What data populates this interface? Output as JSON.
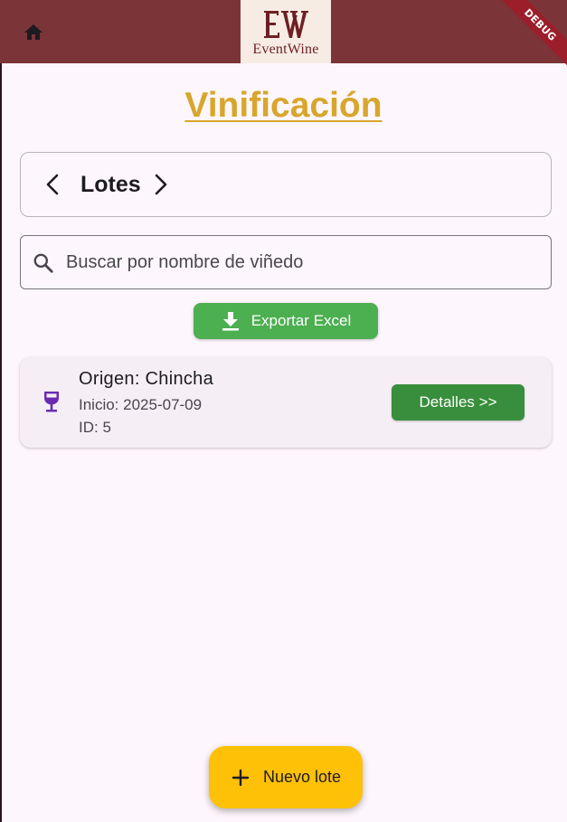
{
  "app_bar": {
    "home_icon": "home-icon",
    "logo": {
      "mark": "EW",
      "text": "EventWine"
    },
    "debug_ribbon": "DEBUG"
  },
  "page": {
    "title": "Vinificación"
  },
  "selector": {
    "prev_icon": "chevron-left-icon",
    "label": "Lotes",
    "next_icon": "chevron-right-icon"
  },
  "search": {
    "icon": "search-icon",
    "placeholder": "Buscar por nombre de viñedo",
    "value": ""
  },
  "export": {
    "icon": "download-icon",
    "label": "Exportar Excel"
  },
  "lots": [
    {
      "icon": "wine-glass-icon",
      "origin": "Origen: Chincha",
      "start": "Inicio: 2025-07-09",
      "id": "ID: 5",
      "details_label": "Detalles >>"
    }
  ],
  "fab": {
    "icon": "plus-icon",
    "label": "Nuevo lote"
  },
  "colors": {
    "app_bar": "#7b3538",
    "title": "#d8a62c",
    "export_button": "#4caf50",
    "details_button": "#388e3c",
    "fab": "#ffc107",
    "background": "#fdf6fc"
  }
}
